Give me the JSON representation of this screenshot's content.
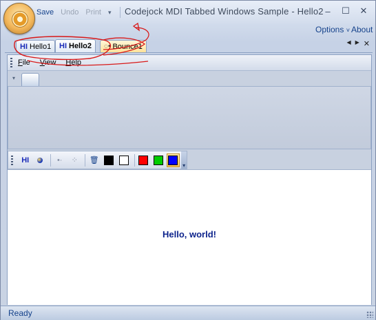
{
  "window": {
    "title": "Codejock MDI Tabbed Windows Sample - Hello2"
  },
  "quick_access": {
    "save": "Save",
    "undo": "Undo",
    "print": "Print",
    "dropdown_icon": "chevron-down-icon"
  },
  "caption_buttons": {
    "minimize": "–",
    "maximize": "☐",
    "close": "✕"
  },
  "ribbon_links": {
    "options": "Options",
    "options_arrow": "˅",
    "about": "About"
  },
  "tabs": [
    {
      "icon": "HI",
      "label": "Hello1",
      "active": false
    },
    {
      "icon": "HI",
      "label": "Hello2",
      "active": true
    },
    {
      "icon": "bounce-icon",
      "label": "Bounce1",
      "active": false
    }
  ],
  "tab_nav": {
    "left": "◀",
    "right": "▶",
    "close": "✕"
  },
  "menu": {
    "file_first": "F",
    "file_rest": "ile",
    "view_first": "V",
    "view_rest": "iew",
    "help_first": "H",
    "help_rest": "elp"
  },
  "toolbar": {
    "hi_label": "HI",
    "colors": [
      "#000000",
      "#ffffff",
      "#ff0000",
      "#00cc00",
      "#0000ff"
    ],
    "selected_color": "#0000ff"
  },
  "content": {
    "message": "Hello, world!"
  },
  "status": {
    "text": "Ready"
  }
}
